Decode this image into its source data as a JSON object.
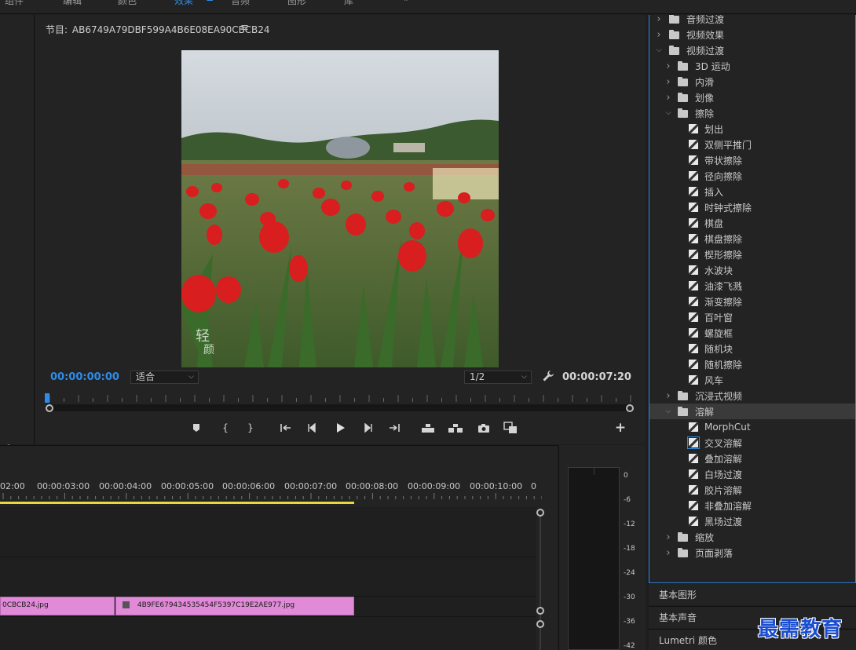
{
  "workspace_tabs": [
    {
      "label": "组件",
      "active": false
    },
    {
      "label": "编辑",
      "active": false
    },
    {
      "label": "颜色",
      "active": false
    },
    {
      "label": "效果",
      "active": true
    },
    {
      "label": "音频",
      "active": false
    },
    {
      "label": "图形",
      "active": false
    },
    {
      "label": "库",
      "active": false
    }
  ],
  "program_monitor": {
    "title_label": "节目:",
    "sequence_name": "AB6749A79DBF599A4B6E08EA90CBCB24",
    "current_time": "00:00:00:00",
    "total_time": "00:00:07:20",
    "fit_value": "适合",
    "resolution_value": "1/2",
    "video_overlay_text": "轻颜"
  },
  "timeline": {
    "ruler_labels": [
      "02:00",
      "00:00:03:00",
      "00:00:04:00",
      "00:00:05:00",
      "00:00:06:00",
      "00:00:07:00",
      "00:00:08:00",
      "00:00:09:00",
      "00:00:10:00",
      "0"
    ],
    "clips": [
      {
        "name": "0CBCB24.jpg"
      },
      {
        "name": "4B9FE679434535454F5397C19E2AE977.jpg"
      }
    ]
  },
  "audio_meter": {
    "db_labels": [
      "0",
      "-6",
      "-12",
      "-18",
      "-24",
      "-30",
      "-36",
      "-42"
    ]
  },
  "effects_panel": {
    "rows": [
      {
        "label": "音频过渡",
        "kind": "folder",
        "level": 0,
        "expanded": false
      },
      {
        "label": "视频效果",
        "kind": "folder",
        "level": 0,
        "expanded": false
      },
      {
        "label": "视频过渡",
        "kind": "folder",
        "level": 0,
        "expanded": true
      },
      {
        "label": "3D 运动",
        "kind": "folder",
        "level": 1,
        "expanded": false
      },
      {
        "label": "内滑",
        "kind": "folder",
        "level": 1,
        "expanded": false
      },
      {
        "label": "划像",
        "kind": "folder",
        "level": 1,
        "expanded": false
      },
      {
        "label": "擦除",
        "kind": "folder",
        "level": 1,
        "expanded": true
      },
      {
        "label": "划出",
        "kind": "effect",
        "level": 2
      },
      {
        "label": "双侧平推门",
        "kind": "effect",
        "level": 2
      },
      {
        "label": "带状擦除",
        "kind": "effect",
        "level": 2
      },
      {
        "label": "径向擦除",
        "kind": "effect",
        "level": 2
      },
      {
        "label": "插入",
        "kind": "effect",
        "level": 2
      },
      {
        "label": "时钟式擦除",
        "kind": "effect",
        "level": 2
      },
      {
        "label": "棋盘",
        "kind": "effect",
        "level": 2
      },
      {
        "label": "棋盘擦除",
        "kind": "effect",
        "level": 2
      },
      {
        "label": "楔形擦除",
        "kind": "effect",
        "level": 2
      },
      {
        "label": "水波块",
        "kind": "effect",
        "level": 2
      },
      {
        "label": "油漆飞溅",
        "kind": "effect",
        "level": 2
      },
      {
        "label": "渐变擦除",
        "kind": "effect",
        "level": 2
      },
      {
        "label": "百叶窗",
        "kind": "effect",
        "level": 2
      },
      {
        "label": "螺旋框",
        "kind": "effect",
        "level": 2
      },
      {
        "label": "随机块",
        "kind": "effect",
        "level": 2
      },
      {
        "label": "随机擦除",
        "kind": "effect",
        "level": 2
      },
      {
        "label": "风车",
        "kind": "effect",
        "level": 2
      },
      {
        "label": "沉浸式视频",
        "kind": "folder",
        "level": 1,
        "expanded": false
      },
      {
        "label": "溶解",
        "kind": "folder",
        "level": 1,
        "expanded": true,
        "selected": true
      },
      {
        "label": "MorphCut",
        "kind": "effect",
        "level": 2
      },
      {
        "label": "交叉溶解",
        "kind": "effect",
        "level": 2,
        "boxed": true
      },
      {
        "label": "叠加溶解",
        "kind": "effect",
        "level": 2
      },
      {
        "label": "白场过渡",
        "kind": "effect",
        "level": 2
      },
      {
        "label": "胶片溶解",
        "kind": "effect",
        "level": 2
      },
      {
        "label": "非叠加溶解",
        "kind": "effect",
        "level": 2
      },
      {
        "label": "黑场过渡",
        "kind": "effect",
        "level": 2
      },
      {
        "label": "缩放",
        "kind": "folder",
        "level": 1,
        "expanded": false
      },
      {
        "label": "页面剥落",
        "kind": "folder",
        "level": 1,
        "expanded": false
      }
    ]
  },
  "bottom_panels": [
    "基本图形",
    "基本声音",
    "Lumetri 颜色"
  ],
  "watermark": "最需教育",
  "colors": {
    "accent": "#2d8ceb",
    "clip": "#e18ad8",
    "work_area": "#e8d93a"
  }
}
